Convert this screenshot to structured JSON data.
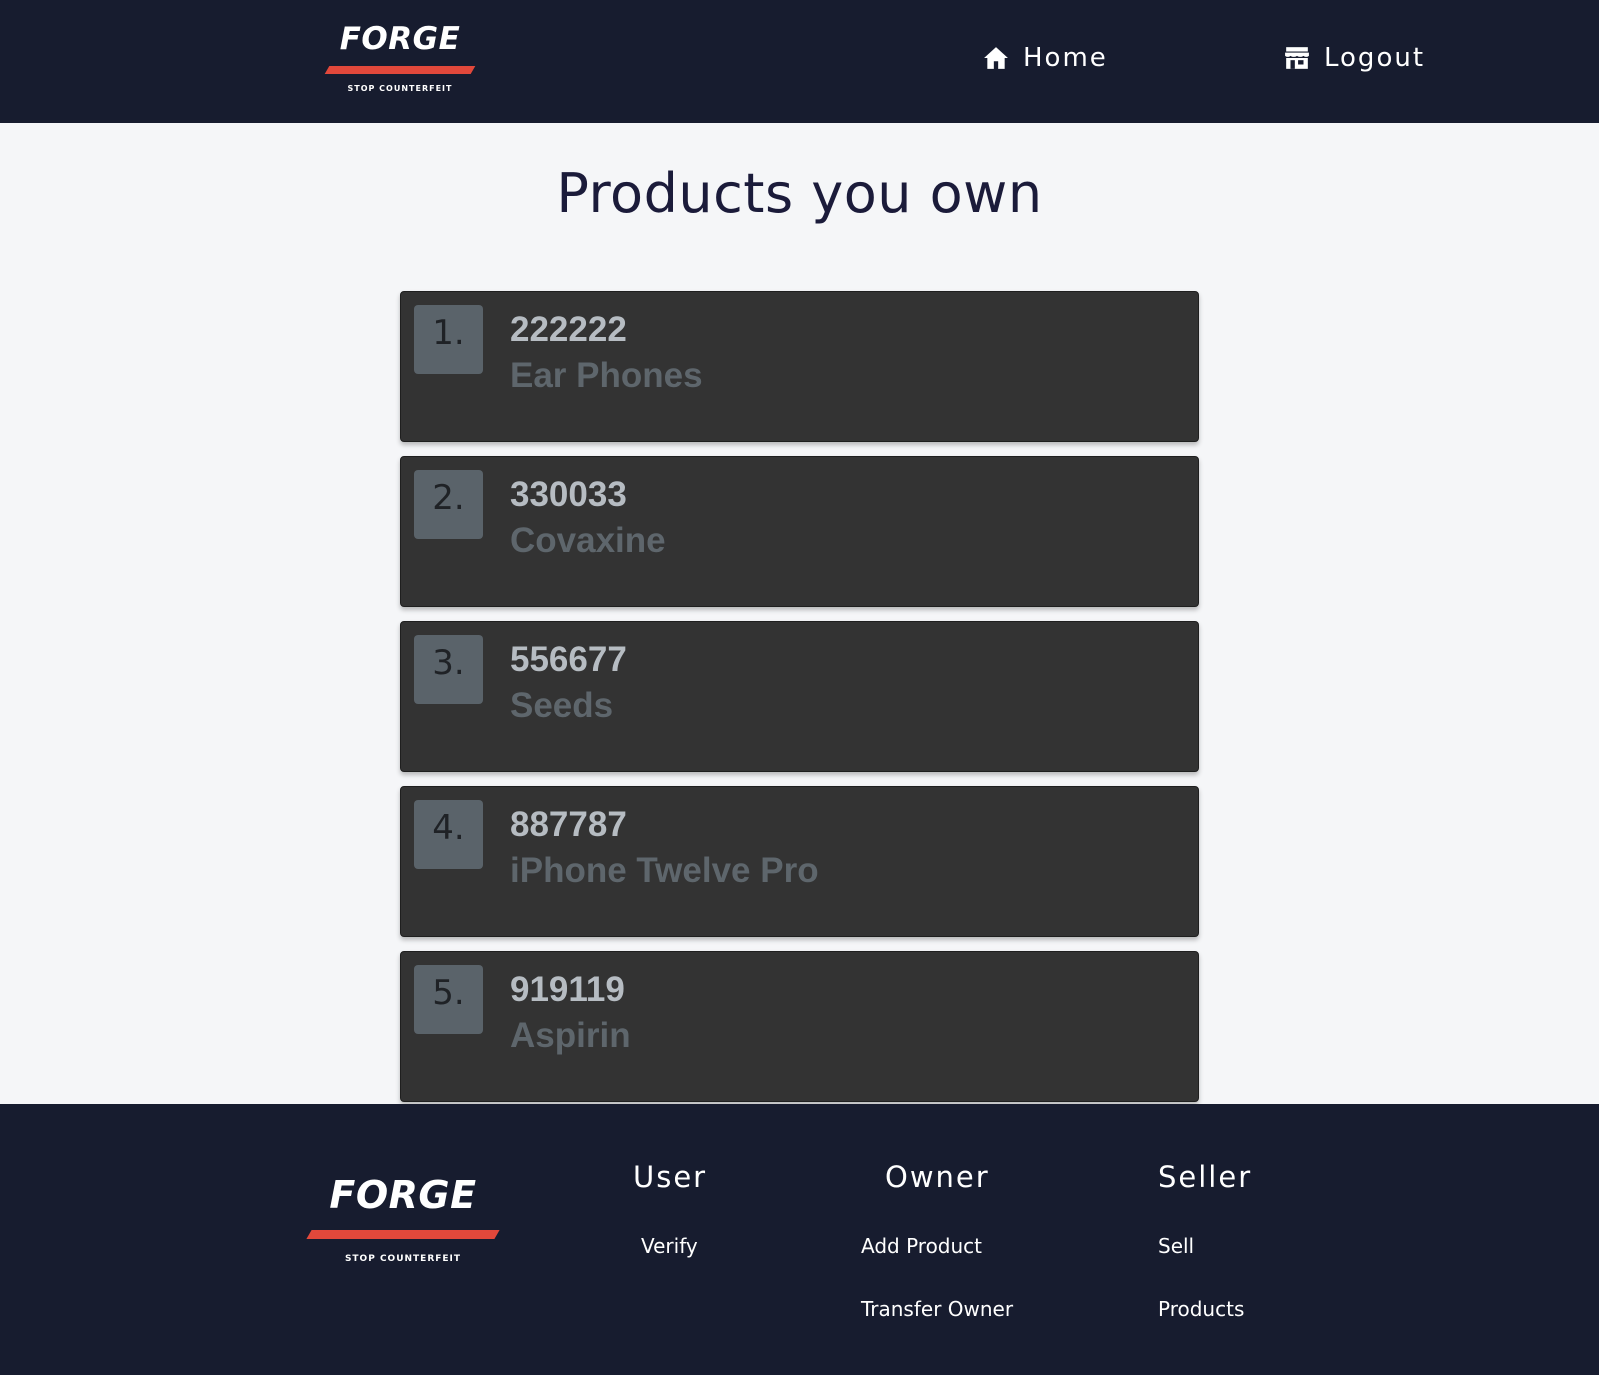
{
  "brand": {
    "name": "FORGE",
    "tagline": "STOP COUNTERFEIT",
    "accent_color": "#e2483b",
    "nav_bg_color": "#171c2f"
  },
  "nav": {
    "home": {
      "label": "Home",
      "icon": "home-icon"
    },
    "logout": {
      "label": "Logout",
      "icon": "store-icon"
    }
  },
  "main": {
    "title": "Products you own",
    "products": [
      {
        "index": "1.",
        "id": "222222",
        "name": "Ear Phones"
      },
      {
        "index": "2.",
        "id": "330033",
        "name": "Covaxine"
      },
      {
        "index": "3.",
        "id": "556677",
        "name": "Seeds"
      },
      {
        "index": "4.",
        "id": "887787",
        "name": "iPhone Twelve Pro"
      },
      {
        "index": "5.",
        "id": "919119",
        "name": "Aspirin"
      }
    ]
  },
  "footer": {
    "user": {
      "heading": "User",
      "links": [
        "Verify"
      ]
    },
    "owner": {
      "heading": "Owner",
      "links": [
        "Add Product",
        "Transfer Owner"
      ]
    },
    "seller": {
      "heading": "Seller",
      "links": [
        "Sell",
        "Products"
      ]
    }
  }
}
